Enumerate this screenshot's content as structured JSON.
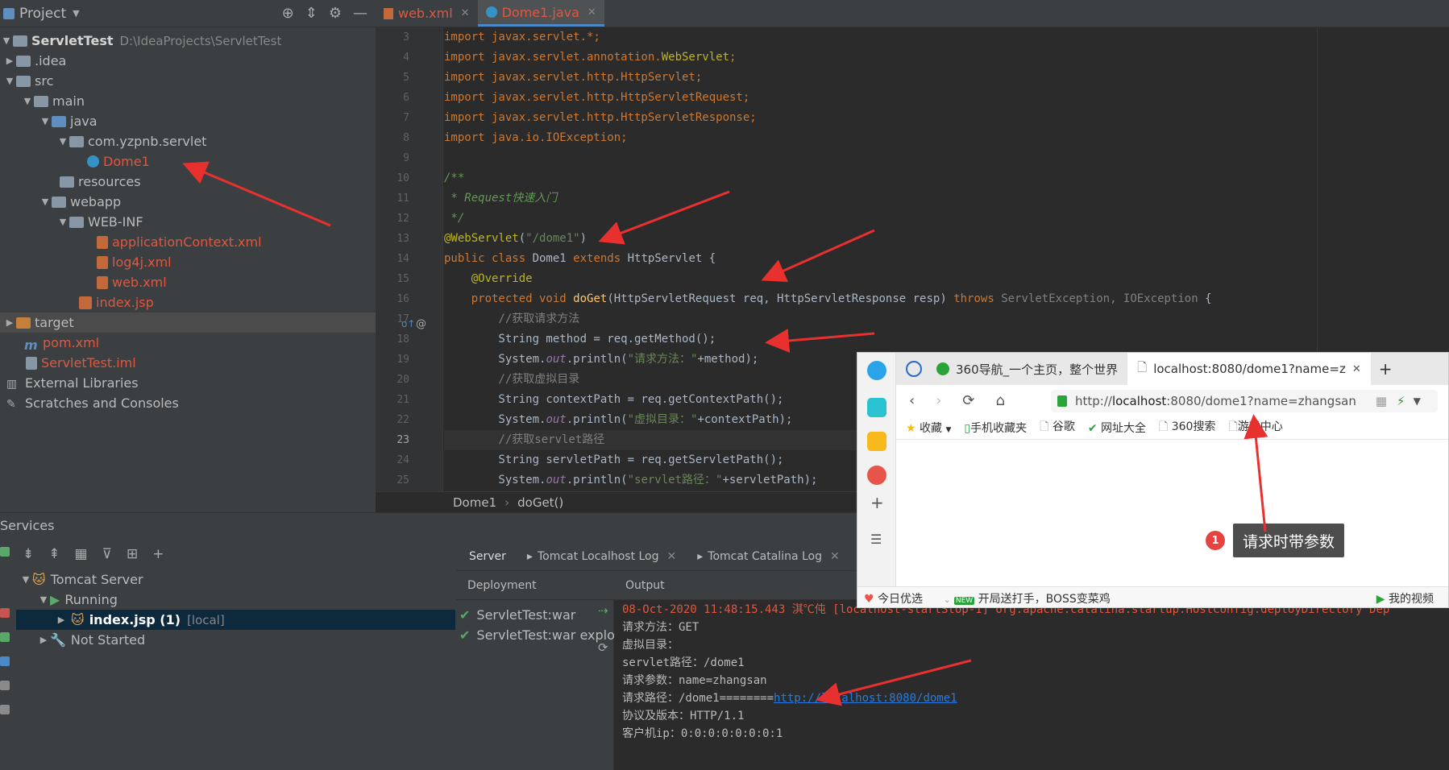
{
  "project": {
    "title": "Project",
    "root_name": "ServletTest",
    "root_path": "D:\\IdeaProjects\\ServletTest",
    "nodes": [
      {
        "label": ".idea"
      },
      {
        "label": "src"
      },
      {
        "label": "main"
      },
      {
        "label": "java"
      },
      {
        "label": "com.yzpnb.servlet"
      },
      {
        "label": "Dome1"
      },
      {
        "label": "resources"
      },
      {
        "label": "webapp"
      },
      {
        "label": "WEB-INF"
      },
      {
        "label": "applicationContext.xml"
      },
      {
        "label": "log4j.xml"
      },
      {
        "label": "web.xml"
      },
      {
        "label": "index.jsp"
      },
      {
        "label": "target"
      },
      {
        "label": "pom.xml"
      },
      {
        "label": "ServletTest.iml"
      },
      {
        "label": "External Libraries"
      },
      {
        "label": "Scratches and Consoles"
      }
    ]
  },
  "editor": {
    "tabs": [
      {
        "label": "web.xml"
      },
      {
        "label": "Dome1.java"
      }
    ],
    "line_numbers": [
      "3",
      "4",
      "5",
      "6",
      "7",
      "8",
      "9",
      "10",
      "11",
      "12",
      "13",
      "14",
      "15",
      "16",
      "17",
      "18",
      "19",
      "20",
      "21",
      "22",
      "23",
      "24",
      "25"
    ],
    "lines": {
      "l3": "import javax.servlet.*;",
      "l4a": "import javax.servlet.annotation.",
      "l4b": "WebServlet",
      "l4c": ";",
      "l5": "import javax.servlet.http.HttpServlet;",
      "l6": "import javax.servlet.http.HttpServletRequest;",
      "l7": "import javax.servlet.http.HttpServletResponse;",
      "l8": "import java.io.IOException;",
      "l10": "/**",
      "l11": " * Request快速入门",
      "l12": " */",
      "l13a": "@WebServlet",
      "l13b": "(",
      "l13c": "\"/dome1\"",
      "l13d": ")",
      "l14a": "public class ",
      "l14b": "Dome1 ",
      "l14c": "extends ",
      "l14d": "HttpServlet {",
      "l15": "    @Override",
      "l16a": "    protected void ",
      "l16b": "doGet",
      "l16c": "(HttpServletRequest req, HttpServletResponse resp) ",
      "l16d": "throws ",
      "l16e": "ServletException, IOException",
      "l16f": " {",
      "l17": "        //获取请求方法",
      "l18": "        String method = req.getMethod();",
      "l19a": "        System.",
      "l19b": "out",
      "l19c": ".println(",
      "l19d": "\"请求方法：\"",
      "l19e": "+method);",
      "l20": "        //获取虚拟目录",
      "l21": "        String contextPath = req.getContextPath();",
      "l22a": "        System.",
      "l22b": "out",
      "l22c": ".println(",
      "l22d": "\"虚拟目录：\"",
      "l22e": "+contextPath);",
      "l23": "        //获取servlet路径",
      "l24": "        String servletPath = req.getServletPath();",
      "l25a": "        System.",
      "l25b": "out",
      "l25c": ".println(",
      "l25d": "\"servlet路径：\"",
      "l25e": "+servletPath);"
    },
    "breadcrumb": [
      "Dome1",
      "doGet()"
    ]
  },
  "services": {
    "title": "Services",
    "tree": [
      {
        "label": "Tomcat Server"
      },
      {
        "label": "Running"
      },
      {
        "label": "index.jsp (1)",
        "suffix": "[local]"
      },
      {
        "label": "Not Started"
      }
    ],
    "tabs": [
      "Server",
      "Tomcat Localhost Log",
      "Tomcat Catalina Log"
    ],
    "deployment_header": "Deployment",
    "output_header": "Output",
    "deployments": [
      "ServletTest:war",
      "ServletTest:war exploded"
    ],
    "output_lines": [
      "08-Oct-2020 11:48:15.443 淇℃伅 [localhost-startStop-1] org.apache.catalina.startup.HostConfig.deployDirectory Dep",
      "请求方法：GET",
      "虚拟目录：",
      "servlet路径：/dome1",
      "请求参数：name=zhangsan",
      "请求路径：/dome1========",
      "协议及版本：HTTP/1.1",
      "客户机ip：0:0:0:0:0:0:0:1"
    ],
    "output_link": "http://localhost:8080/dome1"
  },
  "browser": {
    "tabs": [
      "360导航_一个主页，整个世界",
      "localhost:8080/dome1?name=z"
    ],
    "url_prefix": "http://",
    "url_host": "localhost",
    "url_rest": ":8080/dome1?name=zhangsan",
    "bookmarks": [
      "收藏",
      "手机收藏夹",
      "谷歌",
      "网址大全",
      "360搜索",
      "游戏中心"
    ],
    "status_items": [
      "今日优选",
      "开局送打手，BOSS变菜鸡",
      "我的视频"
    ],
    "new_badge": "NEW",
    "tooltip": "请求时带参数",
    "badge_number": "1"
  },
  "colors": {
    "keyword": "#cc7832",
    "annotation": "#bbb529",
    "string": "#6a8759",
    "comment": "#808080",
    "error_text": "#e0573f",
    "arrow": "#e8312f"
  }
}
